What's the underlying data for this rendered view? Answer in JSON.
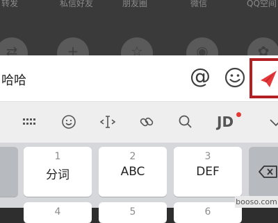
{
  "share_sheet": {
    "items": [
      {
        "label": "转发"
      },
      {
        "label": "私信好友"
      },
      {
        "label": "朋友圈"
      },
      {
        "label": "微信"
      },
      {
        "label": "QQ空间"
      }
    ]
  },
  "input": {
    "text": "哈哈"
  },
  "toolbar": {
    "icons": [
      "keyboard-grid-icon",
      "emoji-icon",
      "cursor-move-icon",
      "link-icon",
      "search-icon",
      "jd-icon",
      "chevron-down-icon"
    ],
    "jd_label": "JD"
  },
  "keyboard": {
    "keys": [
      {
        "num": "1",
        "label": "分词"
      },
      {
        "num": "2",
        "label": "ABC"
      },
      {
        "num": "3",
        "label": "DEF"
      }
    ],
    "next_row_nums": [
      "4",
      "5",
      "6"
    ]
  },
  "watermark": "booso.com",
  "colors": {
    "send_red": "#e5383b",
    "highlight_border": "#b32024",
    "badge_red": "#e53935"
  }
}
